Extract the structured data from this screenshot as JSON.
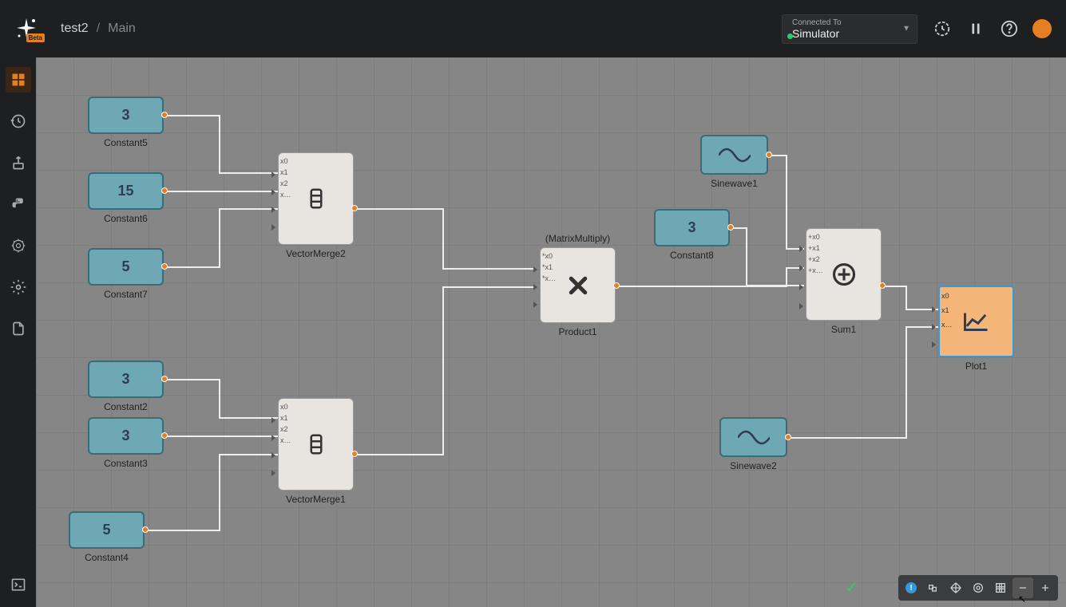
{
  "header": {
    "project": "test2",
    "page": "Main",
    "beta_label": "Beta",
    "connection": {
      "label": "Connected To",
      "value": "Simulator"
    }
  },
  "nodes": {
    "constant5": {
      "value": "3",
      "label": "Constant5"
    },
    "constant6": {
      "value": "15",
      "label": "Constant6"
    },
    "constant7": {
      "value": "5",
      "label": "Constant7"
    },
    "constant2": {
      "value": "3",
      "label": "Constant2"
    },
    "constant3": {
      "value": "3",
      "label": "Constant3"
    },
    "constant4": {
      "value": "5",
      "label": "Constant4"
    },
    "constant8": {
      "value": "3",
      "label": "Constant8"
    },
    "vectormerge2": {
      "label": "VectorMerge2",
      "ports": [
        "x0",
        "x1",
        "x2",
        "x…"
      ]
    },
    "vectormerge1": {
      "label": "VectorMerge1",
      "ports": [
        "x0",
        "x1",
        "x2",
        "x…"
      ]
    },
    "product1": {
      "label": "Product1",
      "supertype": "(MatrixMultiply)",
      "ports": [
        "*x0",
        "*x1",
        "*x…"
      ]
    },
    "sum1": {
      "label": "Sum1",
      "ports": [
        "+x0",
        "+x1",
        "+x2",
        "+x…"
      ]
    },
    "sinewave1": {
      "label": "Sinewave1"
    },
    "sinewave2": {
      "label": "Sinewave2"
    },
    "plot1": {
      "label": "Plot1",
      "ports": [
        "x0",
        "x1",
        "x…"
      ]
    }
  },
  "statusbar": {
    "check": "✓"
  }
}
